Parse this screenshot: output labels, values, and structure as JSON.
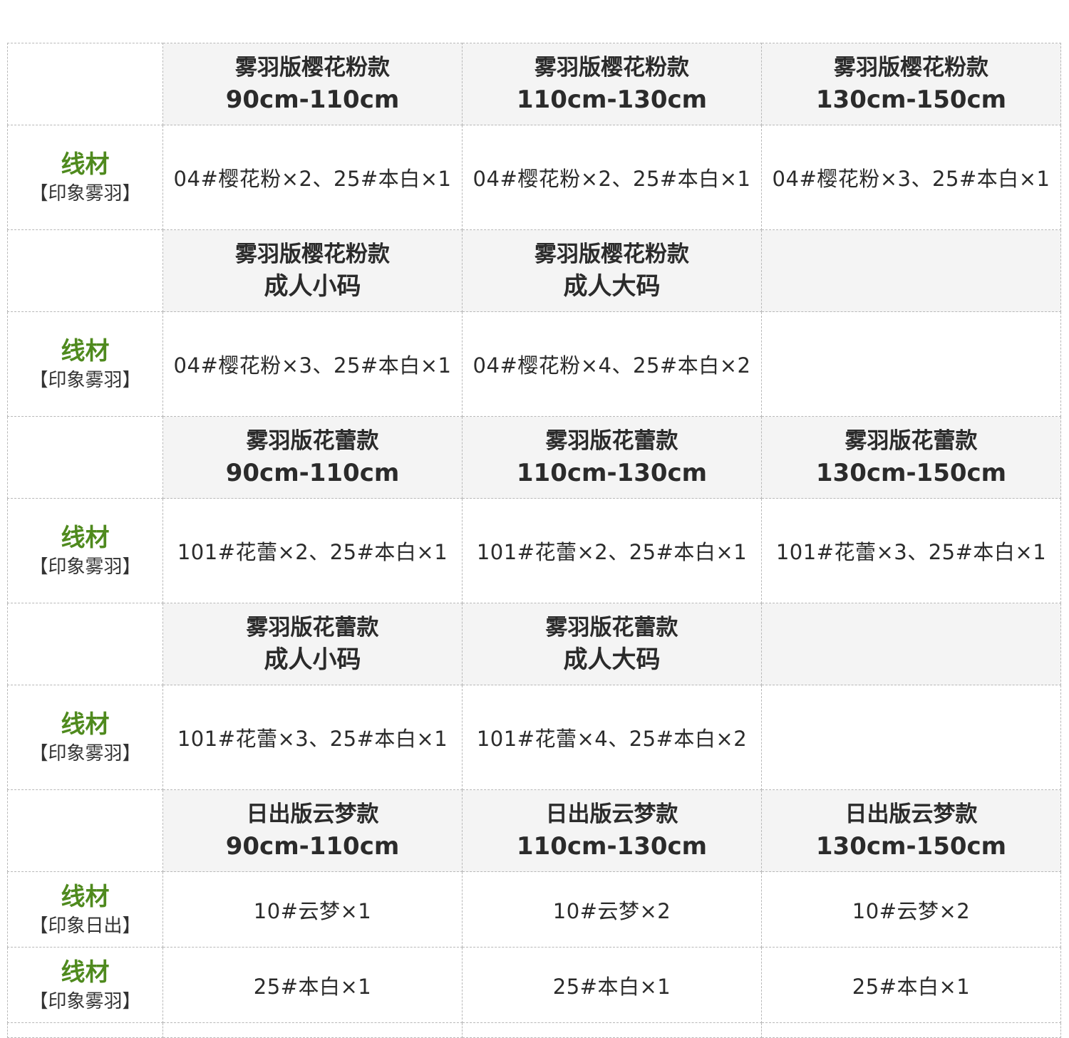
{
  "label": {
    "main": "线材"
  },
  "sections": [
    {
      "headers": [
        {
          "name": "雾羽版樱花粉款",
          "size": "90cm-110cm"
        },
        {
          "name": "雾羽版樱花粉款",
          "size": "110cm-130cm"
        },
        {
          "name": "雾羽版樱花粉款",
          "size": "130cm-150cm"
        }
      ],
      "rows": [
        {
          "label": "线材",
          "sub": "【印象雾羽】",
          "values": [
            "04#樱花粉×2、25#本白×1",
            "04#樱花粉×2、25#本白×1",
            "04#樱花粉×3、25#本白×1"
          ]
        }
      ]
    },
    {
      "headers": [
        {
          "name": "雾羽版樱花粉款",
          "size": "成人小码"
        },
        {
          "name": "雾羽版樱花粉款",
          "size": "成人大码"
        },
        {
          "name": "",
          "size": ""
        }
      ],
      "rows": [
        {
          "label": "线材",
          "sub": "【印象雾羽】",
          "values": [
            "04#樱花粉×3、25#本白×1",
            "04#樱花粉×4、25#本白×2",
            ""
          ]
        }
      ]
    },
    {
      "headers": [
        {
          "name": "雾羽版花蕾款",
          "size": "90cm-110cm"
        },
        {
          "name": "雾羽版花蕾款",
          "size": "110cm-130cm"
        },
        {
          "name": "雾羽版花蕾款",
          "size": "130cm-150cm"
        }
      ],
      "rows": [
        {
          "label": "线材",
          "sub": "【印象雾羽】",
          "values": [
            "101#花蕾×2、25#本白×1",
            "101#花蕾×2、25#本白×1",
            "101#花蕾×3、25#本白×1"
          ]
        }
      ]
    },
    {
      "headers": [
        {
          "name": "雾羽版花蕾款",
          "size": "成人小码"
        },
        {
          "name": "雾羽版花蕾款",
          "size": "成人大码"
        },
        {
          "name": "",
          "size": ""
        }
      ],
      "rows": [
        {
          "label": "线材",
          "sub": "【印象雾羽】",
          "values": [
            "101#花蕾×3、25#本白×1",
            "101#花蕾×4、25#本白×2",
            ""
          ]
        }
      ]
    },
    {
      "headers": [
        {
          "name": "日出版云梦款",
          "size": "90cm-110cm"
        },
        {
          "name": "日出版云梦款",
          "size": "110cm-130cm"
        },
        {
          "name": "日出版云梦款",
          "size": "130cm-150cm"
        }
      ],
      "rows": [
        {
          "label": "线材",
          "sub": "【印象日出】",
          "values": [
            "10#云梦×1",
            "10#云梦×2",
            "10#云梦×2"
          ]
        },
        {
          "label": "线材",
          "sub": "【印象雾羽】",
          "values": [
            "25#本白×1",
            "25#本白×1",
            "25#本白×1"
          ]
        }
      ]
    }
  ]
}
